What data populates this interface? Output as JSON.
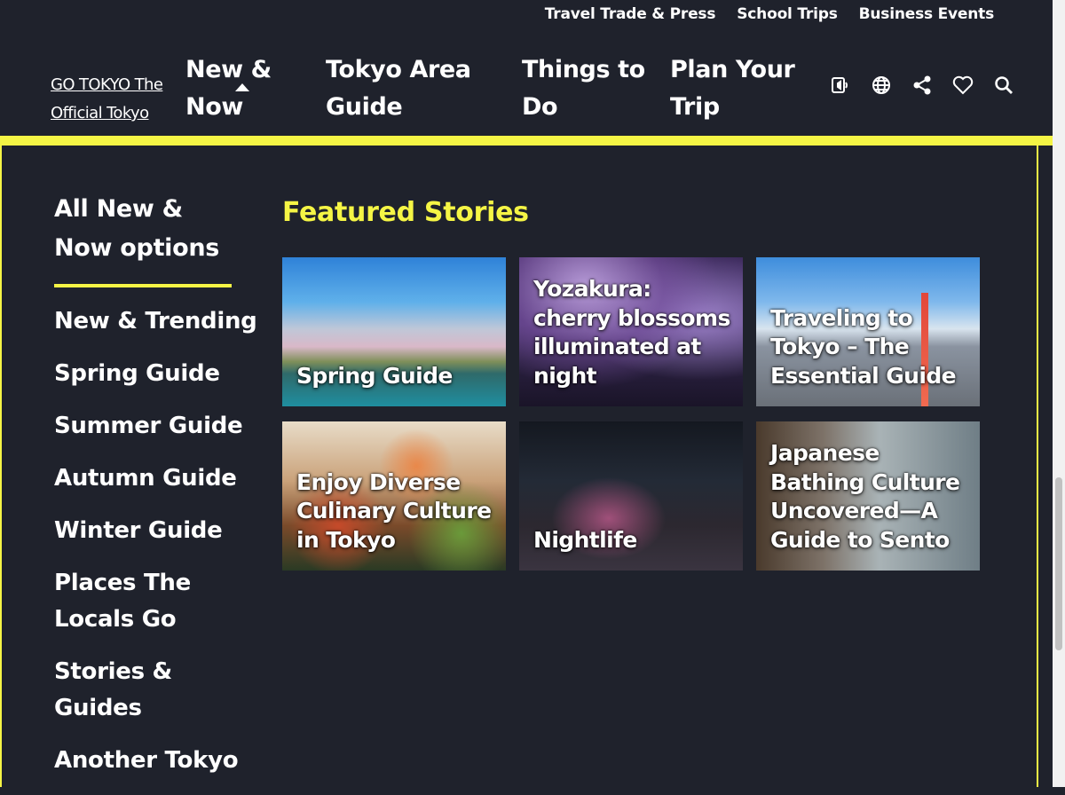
{
  "utility_nav": [
    "Travel Trade & Press",
    "School Trips",
    "Business Events"
  ],
  "logo": {
    "text": "GO TOKYO The Official Tokyo"
  },
  "main_nav": [
    {
      "label_line1": "New &",
      "label_line2": "Now"
    },
    {
      "label_line1": "Tokyo Area",
      "label_line2": "Guide"
    },
    {
      "label_line1": "Things to",
      "label_line2": "Do"
    },
    {
      "label_line1": "Plan Your",
      "label_line2": "Trip"
    }
  ],
  "header_icons": [
    "audio-icon",
    "globe-icon",
    "share-icon",
    "heart-icon",
    "search-icon"
  ],
  "colors": {
    "background": "#1f222c",
    "accent": "#f5f545"
  },
  "side_menu": {
    "title_line1": "All New &",
    "title_line2": "Now options",
    "items": [
      "New & Trending",
      "Spring Guide",
      "Summer Guide",
      "Autumn Guide",
      "Winter Guide",
      "Places The Locals Go",
      "Stories & Guides",
      "Another Tokyo"
    ]
  },
  "featured": {
    "title": "Featured Stories",
    "cards": [
      {
        "caption": "Spring Guide"
      },
      {
        "caption": "Yozakura: cherry blossoms illuminated at night"
      },
      {
        "caption": "Traveling to Tokyo – The Essential Guide"
      },
      {
        "caption": "Enjoy Diverse Culinary Culture in Tokyo"
      },
      {
        "caption": "Nightlife"
      },
      {
        "caption": "Japanese Bathing Culture Uncovered—A Guide to Sento"
      }
    ]
  }
}
